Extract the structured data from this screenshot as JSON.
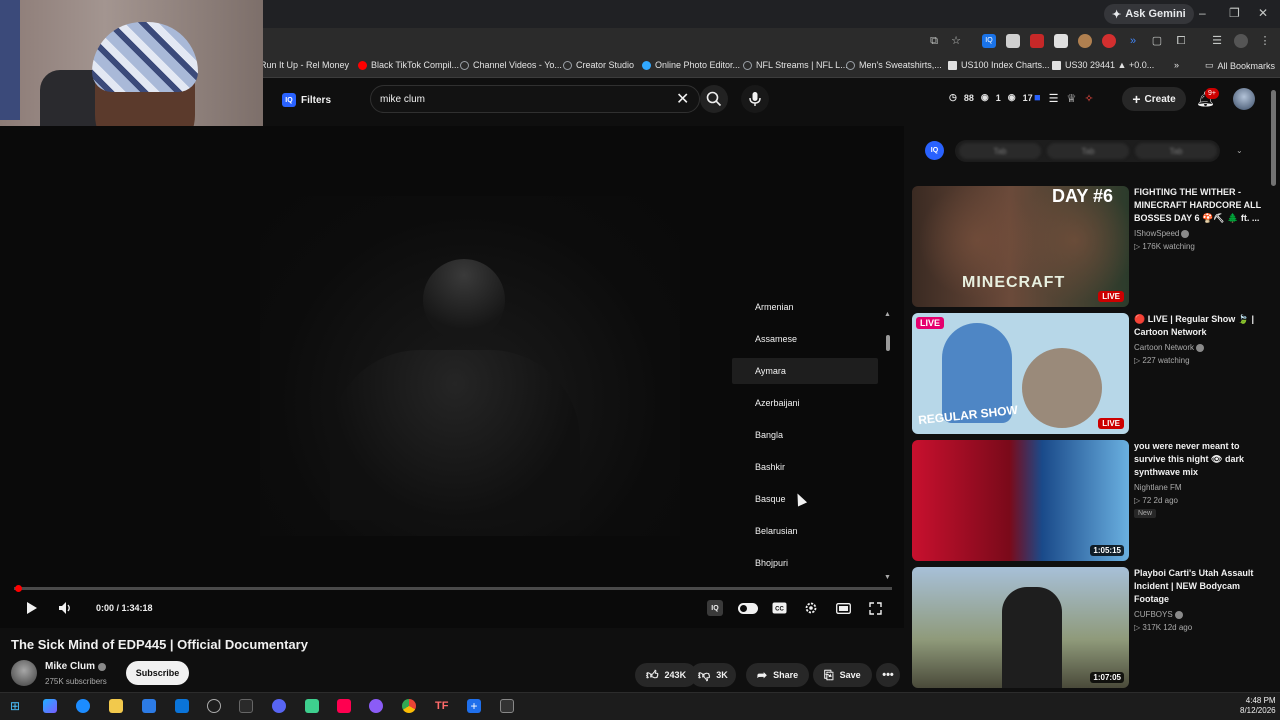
{
  "browser": {
    "gemini_label": "Ask Gemini",
    "bookmarks": [
      {
        "label": "Run It Up - Rel Money",
        "color": "#ff0000"
      },
      {
        "label": "Black TikTok Compil...",
        "color": "#ff0000"
      },
      {
        "label": "Channel Videos - Yo...",
        "color": "#9aa0a6"
      },
      {
        "label": "Creator Studio",
        "color": "#9aa0a6"
      },
      {
        "label": "Online Photo Editor...",
        "color": "#31a8ff"
      },
      {
        "label": "NFL Streams | NFL L...",
        "color": "#9aa0a6"
      },
      {
        "label": "Men's Sweatshirts,...",
        "color": "#9aa0a6"
      },
      {
        "label": "US100 Index Charts...",
        "color": "#ffffff"
      },
      {
        "label": "US30 29441 ▲ +0.0...",
        "color": "#ffffff"
      }
    ],
    "all_bookmarks": "All Bookmarks"
  },
  "header": {
    "filters_label": "Filters",
    "iq_label": "IQ",
    "search_value": "mike clum",
    "stats": [
      "88",
      "1",
      "17"
    ],
    "create_label": "Create",
    "notifications": "9+"
  },
  "player": {
    "time": "0:00 / 1:34:18",
    "languages": [
      "Armenian",
      "Assamese",
      "Aymara",
      "Azerbaijani",
      "Bangla",
      "Bashkir",
      "Basque",
      "Belarusian",
      "Bhojpuri"
    ],
    "active_language": "Aymara",
    "progress": 0
  },
  "video": {
    "title": "The Sick Mind of EDP445 | Official Documentary",
    "channel": "Mike Clum",
    "subscribers": "275K subscribers",
    "subscribe_label": "Subscribe",
    "likes": "243K",
    "dislikes": "3K",
    "share_label": "Share",
    "save_label": "Save"
  },
  "sidebar": {
    "iq_label": "IQ",
    "iq_tabs": [
      "Tab",
      "Tab",
      "Tab"
    ],
    "recommendations": [
      {
        "title": "FIGHTING THE WITHER - MINECRAFT HARDCORE ALL BOSSES DAY 6 🍄⛏ 🌲 ft. ...",
        "channel": "IShowSpeed",
        "meta": "▷ 176K watching",
        "badge": "LIVE",
        "thumb_text": "DAY #6",
        "thumb_text2": "MINECRAFT"
      },
      {
        "title": "🔴 LIVE | Regular Show 🍃 | Cartoon Network",
        "channel": "Cartoon Network",
        "meta": "▷ 227 watching",
        "badge": "LIVE",
        "thumb_text": "LIVE",
        "thumb_text2": "REGULAR SHOW"
      },
      {
        "title": "you were never meant to survive this night 👁 dark synthwave mix",
        "channel": "Nightlane FM",
        "meta": "▷ 72  2d ago",
        "tag": "New",
        "duration": "1:05:15"
      },
      {
        "title": "Playboi Carti's Utah Assault Incident | NEW Bodycam Footage",
        "channel": "CUFBOYS",
        "meta": "▷ 317K  12d ago",
        "duration": "1:07:05"
      }
    ]
  },
  "taskbar": {
    "time": "4:48 PM",
    "date": "8/12/2026"
  },
  "colors": {
    "accent_red": "#ff0000",
    "iq_blue": "#2962ff",
    "background": "#0f0f0f"
  }
}
